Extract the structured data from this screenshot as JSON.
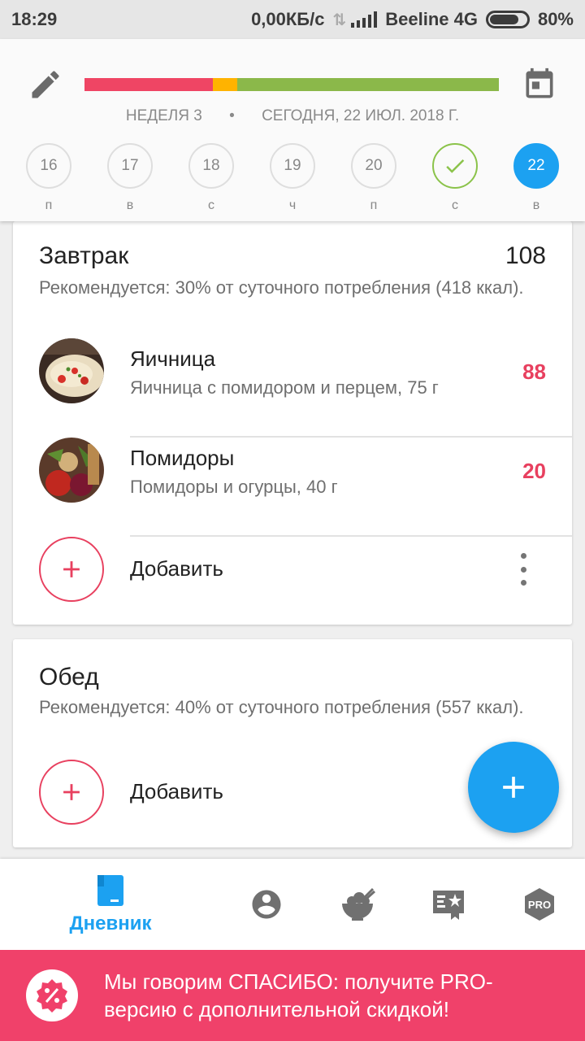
{
  "status_bar": {
    "time": "18:29",
    "speed": "0,00КБ/с",
    "carrier": "Beeline 4G",
    "battery": "80%",
    "battery_level": 0.8
  },
  "header": {
    "edit_icon": "pencil-icon",
    "calendar_icon": "calendar-icon",
    "progress_colors": [
      "#ef4564",
      "#ffb300",
      "#8bb84a"
    ],
    "week_label": "НЕДЕЛЯ 3",
    "separator": "•",
    "today_label": "СЕГОДНЯ, 22 ИЮЛ. 2018 Г.",
    "days": [
      {
        "num": "16",
        "letter": "п",
        "state": "normal"
      },
      {
        "num": "17",
        "letter": "в",
        "state": "normal"
      },
      {
        "num": "18",
        "letter": "с",
        "state": "normal"
      },
      {
        "num": "19",
        "letter": "ч",
        "state": "normal"
      },
      {
        "num": "20",
        "letter": "п",
        "state": "normal"
      },
      {
        "num": "",
        "letter": "с",
        "state": "done"
      },
      {
        "num": "22",
        "letter": "в",
        "state": "current"
      }
    ]
  },
  "breakfast": {
    "title": "Завтрак",
    "total": "108",
    "recommendation": "Рекомендуется: 30% от суточного потребления (418 ккал).",
    "items": [
      {
        "name": "Яичница",
        "desc": "Яичница с помидором и перцем, 75 г",
        "kcal": "88"
      },
      {
        "name": "Помидоры",
        "desc": "Помидоры и огурцы, 40 г",
        "kcal": "20"
      }
    ],
    "add_label": "Добавить"
  },
  "lunch": {
    "title": "Обед",
    "recommendation": "Рекомендуется: 40% от суточного потребления (557 ккал).",
    "add_label": "Добавить"
  },
  "fab": {
    "icon": "plus-icon"
  },
  "bottom_nav": {
    "diary_label": "Дневник",
    "icons": [
      "diary-icon",
      "profile-icon",
      "recipes-icon",
      "achievements-icon",
      "pro-icon"
    ],
    "pro_text": "PRO"
  },
  "promo": {
    "text": "Мы говорим СПАСИБО: получите PRO-версию с дополнительной скидкой!",
    "icon": "discount-badge-icon"
  },
  "colors": {
    "accent_blue": "#1ca1f1",
    "accent_pink": "#e8405f",
    "promo_bg": "#f0416a",
    "done_green": "#8bc34a"
  }
}
